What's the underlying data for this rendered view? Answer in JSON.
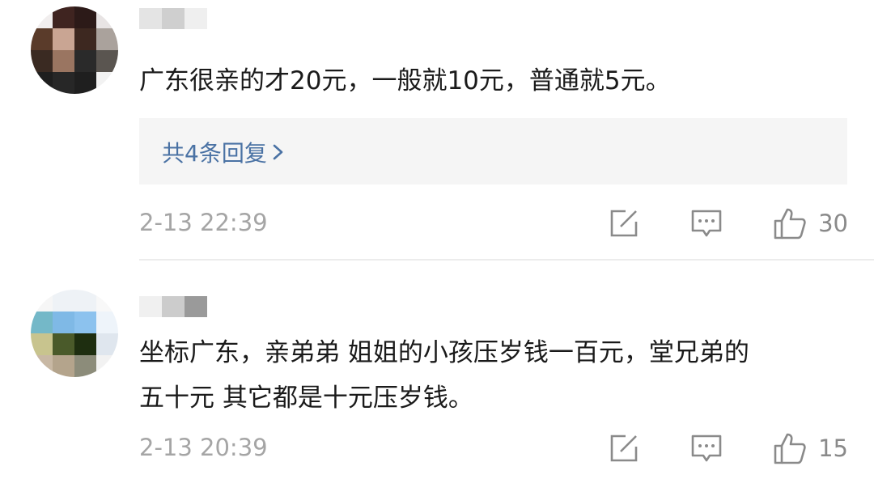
{
  "comments": [
    {
      "text_lines": [
        "广东很亲的才20元，一般就10元，普通就5元。"
      ],
      "replies_label": "共4条回复",
      "timestamp": "2-13 22:39",
      "like_count": "30"
    },
    {
      "text_lines": [
        "坐标广东，亲弟弟 姐姐的小孩压岁钱一百元，堂兄弟的",
        "五十元 其它都是十元压岁钱。"
      ],
      "timestamp": "2-13 20:39",
      "like_count": "15"
    }
  ],
  "colors": {
    "link": "#4a72a4",
    "meta_text": "#a5a5a5",
    "icon": "#8a8a8a",
    "reply_bg": "#f5f5f5"
  },
  "icons": [
    "share-icon",
    "comment-icon",
    "thumbs-up-icon",
    "chevron-right-icon"
  ]
}
